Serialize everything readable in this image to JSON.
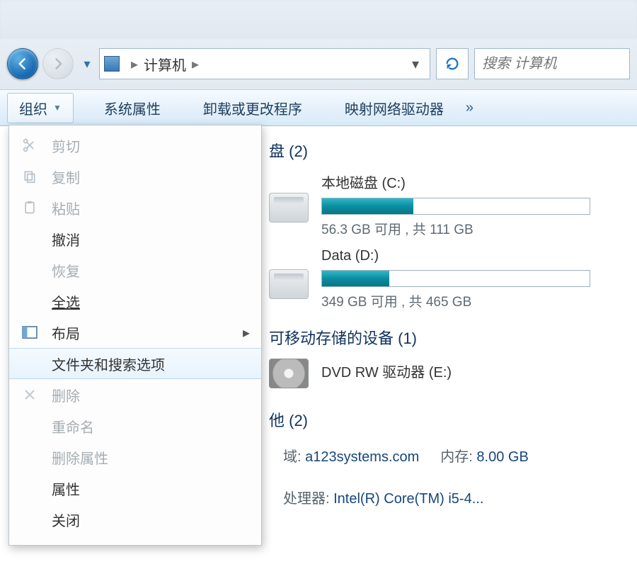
{
  "nav": {
    "breadcrumb_root": "计算机",
    "search_placeholder": "搜索 计算机"
  },
  "toolbar": {
    "organize": "组织",
    "system_props": "系统属性",
    "uninstall": "卸载或更改程序",
    "map_drive": "映射网络驱动器",
    "overflow": "»"
  },
  "orgmenu": {
    "cut": "剪切",
    "copy": "复制",
    "paste": "粘贴",
    "undo": "撤消",
    "redo": "恢复",
    "selectall": "全选",
    "layout": "布局",
    "folderopts": "文件夹和搜索选项",
    "delete": "删除",
    "rename": "重命名",
    "rmprops": "删除属性",
    "props": "属性",
    "close": "关闭"
  },
  "content": {
    "grp_hdd": "盘 (2)",
    "drive_c": {
      "name": "本地磁盘 (C:)",
      "sub": "56.3 GB 可用 , 共 111 GB",
      "fill_pct": 34
    },
    "drive_d": {
      "name": "Data (D:)",
      "sub": "349 GB 可用 , 共 465 GB",
      "fill_pct": 25
    },
    "grp_removable": "可移动存储的设备 (1)",
    "dvd_name": "DVD RW 驱动器 (E:)",
    "grp_other": "他 (2)",
    "sys": {
      "domain_k": "域:",
      "domain_v": "a123systems.com",
      "mem_k": "内存:",
      "mem_v": "8.00 GB",
      "cpu_k": "处理器:",
      "cpu_v": "Intel(R) Core(TM) i5-4..."
    }
  }
}
